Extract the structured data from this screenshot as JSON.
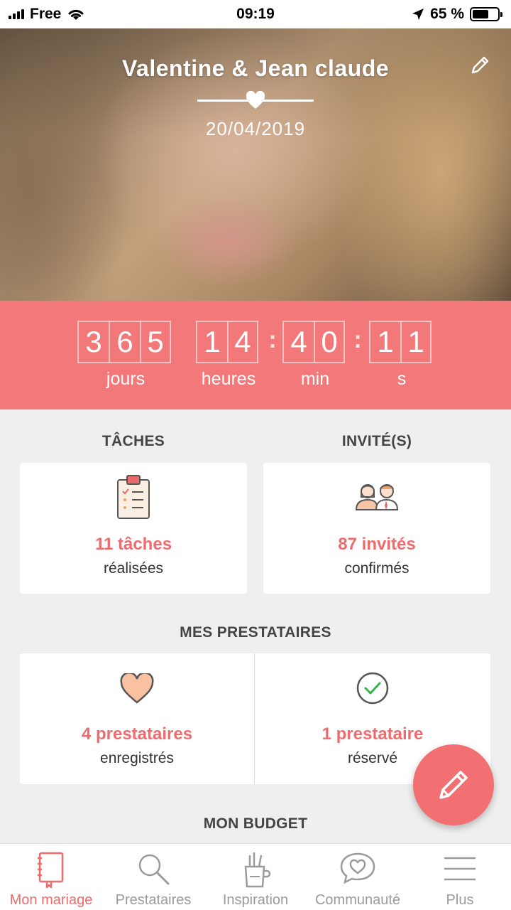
{
  "status_bar": {
    "carrier": "Free",
    "time": "09:19",
    "battery": "65 %",
    "battery_level": 0.65
  },
  "header": {
    "couple_names": "Valentine & Jean claude",
    "date": "20/04/2019",
    "edit_icon": "pencil-icon"
  },
  "countdown": {
    "days_digits": [
      "3",
      "6",
      "5"
    ],
    "hours_digits": [
      "1",
      "4"
    ],
    "minutes_digits": [
      "4",
      "0"
    ],
    "seconds_digits": [
      "1",
      "1"
    ],
    "days_label": "jours",
    "hours_label": "heures",
    "minutes_label": "min",
    "seconds_label": "s",
    "separator": ":",
    "background": "#f37879"
  },
  "tasks": {
    "title": "TÂCHES",
    "value": "11 tâches",
    "sub": "réalisées",
    "icon": "clipboard-icon"
  },
  "guests": {
    "title": "INVITÉ(S)",
    "value": "87 invités",
    "sub": "confirmés",
    "icon": "guests-icon"
  },
  "vendors": {
    "title": "MES PRESTATAIRES",
    "saved": {
      "value": "4 prestataires",
      "sub": "enregistrés",
      "icon": "heart-icon"
    },
    "booked": {
      "value": "1 prestataire",
      "sub": "réservé",
      "icon": "check-circle-icon"
    }
  },
  "budget": {
    "title": "MON BUDGET"
  },
  "tabbar": {
    "items": [
      {
        "label": "Mon mariage",
        "icon": "notebook-icon",
        "active": true
      },
      {
        "label": "Prestataires",
        "icon": "search-icon",
        "active": false
      },
      {
        "label": "Inspiration",
        "icon": "pencil-cup-icon",
        "active": false
      },
      {
        "label": "Communauté",
        "icon": "chat-heart-icon",
        "active": false
      },
      {
        "label": "Plus",
        "icon": "menu-icon",
        "active": false
      }
    ]
  },
  "colors": {
    "accent": "#ef6b6d",
    "background": "#efefef"
  }
}
